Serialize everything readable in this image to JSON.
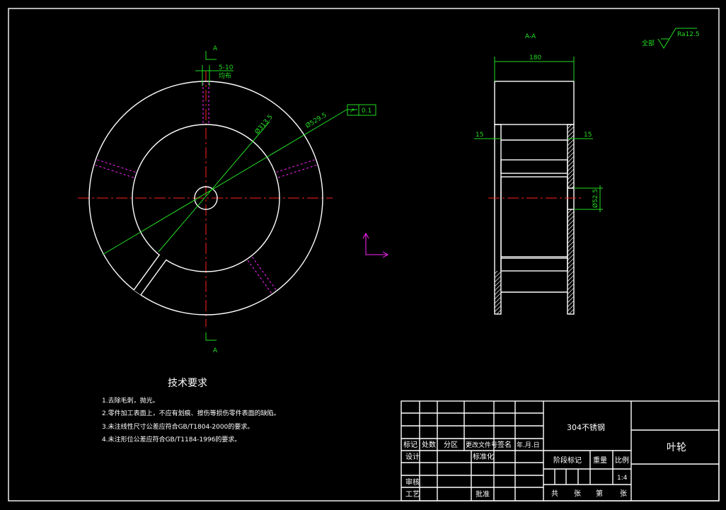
{
  "section_label": "A-A",
  "section_marks": [
    "A",
    "A"
  ],
  "surface_finish": {
    "prefix": "全部",
    "value": "Ra12.5"
  },
  "dimensions": {
    "slot": "5-10",
    "slot_note": "均布",
    "outer_dia": "Ø529.5",
    "inner_dia": "Ø313.5",
    "width": "180",
    "wall_left": "15",
    "wall_right": "15",
    "bore": "Ø52.5"
  },
  "tolerance": {
    "symbol": "↗",
    "value": "0.1"
  },
  "tech_requirements": {
    "title": "技术要求",
    "items": [
      "1.去除毛刺，抛光。",
      "2.零件加工表面上，不应有划痕、擦伤等损伤零件表面的缺陷。",
      "3.未注线性尺寸公差应符合GB/T1804-2000的要求。",
      "4.未注形位公差应符合GB/T1184-1996的要求。"
    ]
  },
  "title_block": {
    "material": "304不锈钢",
    "part_name": "叶轮",
    "header": [
      "标记",
      "处数",
      "分区",
      "更改文件号",
      "签名",
      "年.月.日"
    ],
    "design": "设计",
    "standardization": "标准化",
    "review": "审核",
    "process": "工艺",
    "approve": "批准",
    "stage_mark": "阶段标记",
    "weight": "重量",
    "scale_label": "比例",
    "scale_value": "1:4",
    "sheets": [
      "共",
      "张",
      "第",
      "张"
    ]
  },
  "colors": {
    "outline": "#ffffff",
    "centerline": "#ff2020",
    "dimension": "#22dd22",
    "hidden": "#ff22ff",
    "background": "#000000"
  }
}
